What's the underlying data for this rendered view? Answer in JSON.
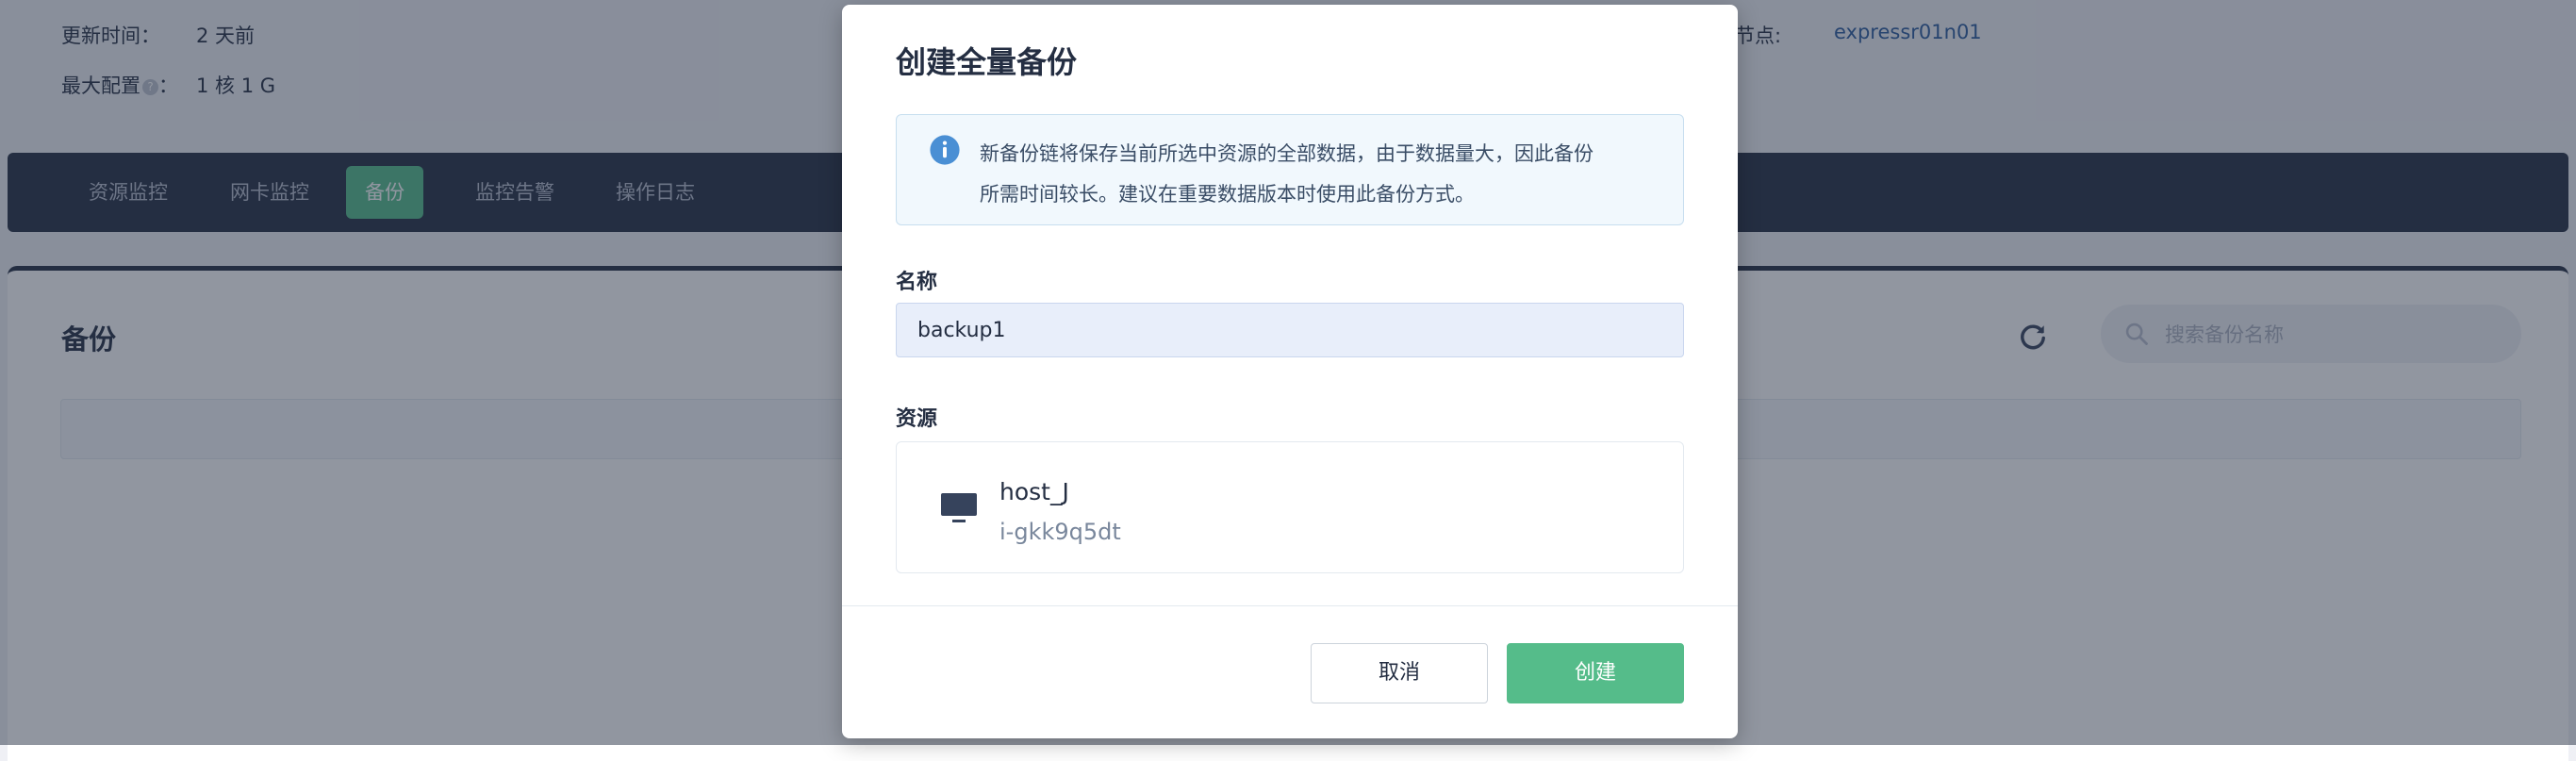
{
  "info": {
    "update_time_label": "更新时间：",
    "update_time_value": "2 天前",
    "max_config_label": "最大配置",
    "max_config_colon": "：",
    "max_config_value": "1 核 1 G",
    "node_label": "节点:",
    "node_value": "expressr01n01"
  },
  "tabs": [
    {
      "label": "资源监控"
    },
    {
      "label": "网卡监控"
    },
    {
      "label": "备份",
      "active": true
    },
    {
      "label": "监控告警"
    },
    {
      "label": "操作日志"
    }
  ],
  "panel": {
    "title": "备份",
    "search_placeholder": "搜索备份名称"
  },
  "modal": {
    "title": "创建全量备份",
    "notice_line1": "新备份链将保存当前所选中资源的全部数据，由于数据量大，因此备份",
    "notice_line2": "所需时间较长。建议在重要数据版本时使用此备份方式。",
    "name_label": "名称",
    "name_value": "backup1",
    "resource_label": "资源",
    "resource": {
      "name": "host_J",
      "id": "i-gkk9q5dt"
    },
    "cancel_label": "取消",
    "create_label": "创建"
  },
  "colors": {
    "accent": "#55bc8a",
    "dark": "#242e42",
    "info": "#4a8fd4"
  }
}
